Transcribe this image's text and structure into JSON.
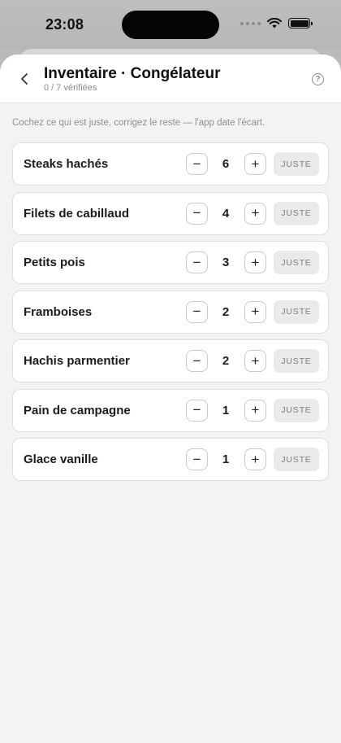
{
  "status_bar": {
    "time": "23:08"
  },
  "header": {
    "title": "Inventaire · Congélateur",
    "subtitle": "0 / 7 vérifiées",
    "help_glyph": "?"
  },
  "hint": "Cochez ce qui est juste, corrigez le reste — l'app date l'écart.",
  "controls": {
    "minus": "−",
    "plus": "+",
    "ok_label": "JUSTE"
  },
  "items": [
    {
      "label": "Steaks hachés",
      "qty": "6"
    },
    {
      "label": "Filets de cabillaud",
      "qty": "4"
    },
    {
      "label": "Petits pois",
      "qty": "3"
    },
    {
      "label": "Framboises",
      "qty": "2"
    },
    {
      "label": "Hachis parmentier",
      "qty": "2"
    },
    {
      "label": "Pain de campagne",
      "qty": "1"
    },
    {
      "label": "Glace vanille",
      "qty": "1"
    }
  ],
  "icons": {
    "back": "chevron-left-icon",
    "help": "question-circle-icon",
    "signal": "cellular-signal-icon",
    "wifi": "wifi-icon",
    "battery": "battery-icon"
  }
}
